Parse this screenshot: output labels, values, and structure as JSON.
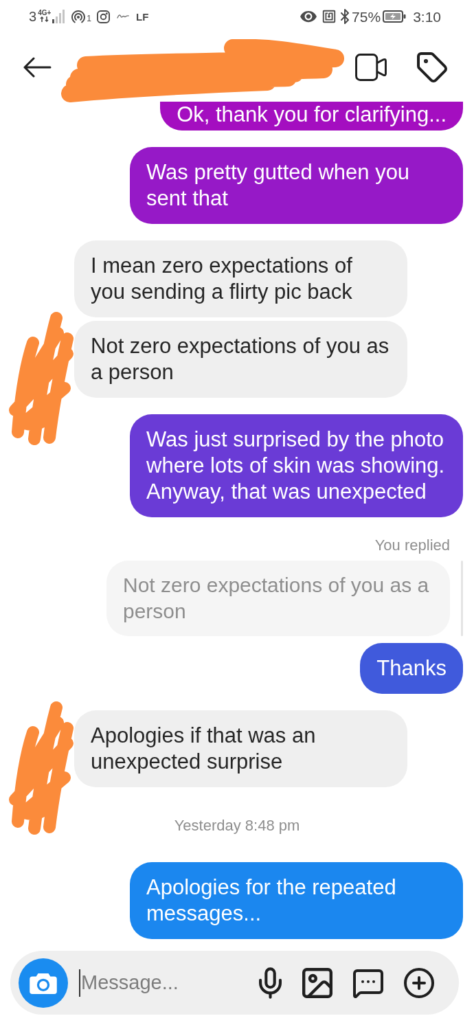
{
  "status_bar": {
    "network_slot": "3",
    "network_type": "4G+",
    "hotspot_count": "1",
    "carrier": "LF",
    "battery": "75%",
    "time": "3:10"
  },
  "messages": [
    {
      "kind": "sent",
      "text": "Ok, thank you for clarifying..."
    },
    {
      "kind": "sent",
      "text": "Was pretty gutted when you sent that"
    },
    {
      "kind": "received",
      "text": "I mean zero expectations of you sending a flirty pic back",
      "redacted_avatar": false
    },
    {
      "kind": "received",
      "text": "Not zero expectations of you as a person",
      "redacted_avatar": true
    },
    {
      "kind": "sent",
      "text": "Was just surprised by the photo where lots of skin was showing. Anyway, that was unexpected"
    },
    {
      "kind": "reply_label",
      "text": "You replied"
    },
    {
      "kind": "quoted",
      "text": "Not zero expectations of you as a person"
    },
    {
      "kind": "sent",
      "text": "Thanks"
    },
    {
      "kind": "received",
      "text": "Apologies if that was an unexpected surprise",
      "redacted_avatar": true
    },
    {
      "kind": "timestamp",
      "text": "Yesterday 8:48 pm"
    },
    {
      "kind": "sent",
      "text": "Apologies for the repeated messages..."
    }
  ],
  "composer": {
    "placeholder": "Message..."
  }
}
